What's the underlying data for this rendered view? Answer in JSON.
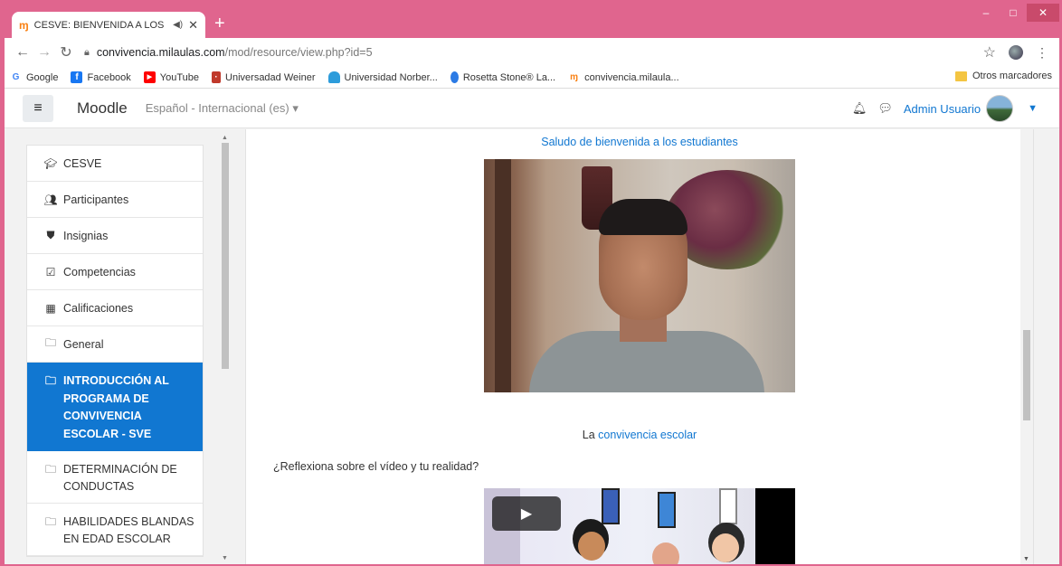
{
  "browser": {
    "tab_title": "CESVE: BIENVENIDA A LOS E",
    "tab_favicon": "moodle-icon",
    "url_host": "convivencia.milaulas.com",
    "url_path": "/mod/resource/view.php?id=5",
    "window_buttons": [
      "–",
      "□",
      "✕"
    ],
    "bookmarks": [
      {
        "label": "Google",
        "icon": "google-icon",
        "color": "#4285f4"
      },
      {
        "label": "Facebook",
        "icon": "facebook-icon",
        "color": "#1877f2"
      },
      {
        "label": "YouTube",
        "icon": "youtube-icon",
        "color": "#ff0000"
      },
      {
        "label": "Universadad Weiner",
        "icon": "weiner-icon",
        "color": "#c0392b"
      },
      {
        "label": "Universidad Norber...",
        "icon": "norbert-icon",
        "color": "#2d9cdb"
      },
      {
        "label": "Rosetta Stone® La...",
        "icon": "rosetta-icon",
        "color": "#2c7be5"
      },
      {
        "label": "convivencia.milaula...",
        "icon": "moodle-icon",
        "color": "#f98012"
      }
    ],
    "other_bookmarks": "Otros marcadores"
  },
  "moodle_header": {
    "brand": "Moodle",
    "language": "Español - Internacional (es)",
    "user_name": "Admin Usuario",
    "accent": "#1177d1"
  },
  "sidebar": {
    "items": [
      {
        "label": "CESVE",
        "icon": "graduation-cap-icon"
      },
      {
        "label": "Participantes",
        "icon": "users-icon"
      },
      {
        "label": "Insignias",
        "icon": "shield-icon"
      },
      {
        "label": "Competencias",
        "icon": "checkbox-icon"
      },
      {
        "label": "Calificaciones",
        "icon": "table-icon"
      },
      {
        "label": "General",
        "icon": "folder-icon"
      },
      {
        "label": "INTRODUCCIÓN AL PROGRAMA DE CONVIVENCIA ESCOLAR - SVE",
        "icon": "folder-icon",
        "active": true
      },
      {
        "label": "DETERMINACIÓN DE CONDUCTAS",
        "icon": "folder-icon"
      },
      {
        "label": "HABILIDADES BLANDAS EN EDAD ESCOLAR",
        "icon": "folder-icon"
      }
    ]
  },
  "main": {
    "welcome_link": "Saludo de bienvenida a los estudiantes",
    "conv_prefix": "La",
    "conv_link": "convivencia escolar",
    "question": "¿Reflexiona sobre el vídeo y tu realidad?"
  }
}
